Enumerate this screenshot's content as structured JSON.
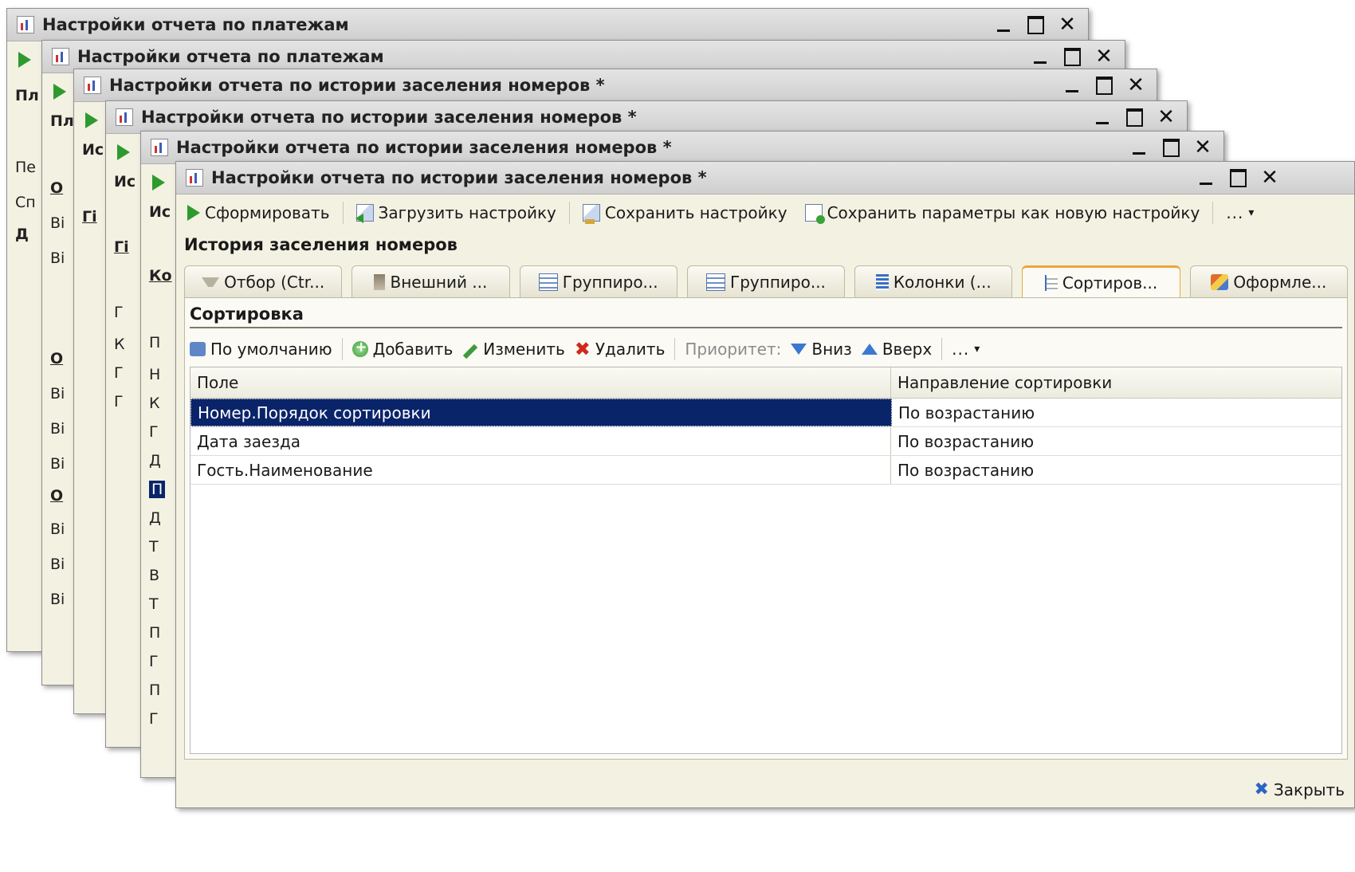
{
  "windows": {
    "w1": {
      "title": "Настройки отчета по платежам"
    },
    "w2": {
      "title": "Настройки отчета по платежам"
    },
    "w3": {
      "title": "Настройки отчета по истории заселения номеров *"
    },
    "w4": {
      "title": "Настройки отчета по истории заселения номеров *"
    },
    "w5": {
      "title": "Настройки отчета по истории заселения номеров *"
    },
    "w6": {
      "title": "Настройки отчета по истории заселения номеров *"
    }
  },
  "fragments": {
    "w1": [
      "Пл",
      "Пе",
      "Сп",
      "Д"
    ],
    "w2": [
      "Пл",
      "О",
      "Ві",
      "Ві",
      "О",
      "Ві",
      "Ві",
      "Ві",
      "О",
      "Ві",
      "Ві",
      "Ві"
    ],
    "w3": [
      "Ис",
      "Гі"
    ],
    "w4": [
      "Ис",
      "Гі",
      "Г",
      "К",
      "Г",
      "Г"
    ],
    "w5": [
      "Ис",
      "Ко",
      "П",
      "Н",
      "К",
      "Г",
      "Д",
      "П",
      "Д",
      "Т",
      "В",
      "Т",
      "П",
      "Г",
      "П",
      "Г"
    ]
  },
  "toolbar": {
    "generate": "Сформировать",
    "load": "Загрузить настройку",
    "save": "Сохранить настройку",
    "save_new": "Сохранить параметры как новую настройку",
    "more": "..."
  },
  "report_title": "История заселения номеров",
  "tabs": [
    {
      "label": "Отбор (Ctr...",
      "icon": "filter-icon"
    },
    {
      "label": "Внешний ...",
      "icon": "external-icon"
    },
    {
      "label": "Группиро...",
      "icon": "grouping-icon"
    },
    {
      "label": "Группиро...",
      "icon": "grouping-table-icon"
    },
    {
      "label": "Колонки (...",
      "icon": "columns-icon"
    },
    {
      "label": "Сортиров...",
      "icon": "sort-icon"
    },
    {
      "label": "Оформле...",
      "icon": "appearance-icon"
    }
  ],
  "sort_panel": {
    "title": "Сортировка",
    "default": "По умолчанию",
    "add": "Добавить",
    "edit": "Изменить",
    "delete": "Удалить",
    "priority": "Приоритет:",
    "down": "Вниз",
    "up": "Вверх",
    "more": "..."
  },
  "grid": {
    "headers": [
      "Поле",
      "Направление сортировки"
    ],
    "rows": [
      [
        "Номер.Порядок сортировки",
        "По возрастанию"
      ],
      [
        "Дата заезда",
        "По возрастанию"
      ],
      [
        "Гость.Наименование",
        "По возрастанию"
      ]
    ]
  },
  "footer": {
    "close": "Закрыть"
  },
  "colors": {
    "selection": "#0a246a",
    "window_bg": "#f3f1e2",
    "active_tab": "#e9a73b"
  }
}
